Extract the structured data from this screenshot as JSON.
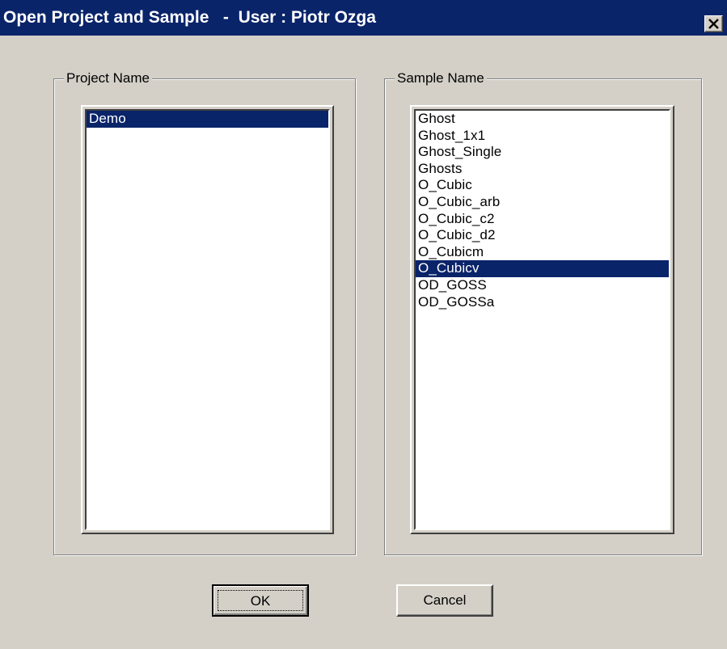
{
  "window": {
    "title": "Open Project and Sample   -  User : Piotr Ozga",
    "close_icon": "close-icon"
  },
  "project_group": {
    "label": "Project Name",
    "items": [
      "Demo"
    ],
    "selected_index": 0
  },
  "sample_group": {
    "label": "Sample Name",
    "items": [
      "Ghost",
      "Ghost_1x1",
      "Ghost_Single",
      "Ghosts",
      "O_Cubic",
      "O_Cubic_arb",
      "O_Cubic_c2",
      "O_Cubic_d2",
      "O_Cubicm",
      "O_Cubicv",
      "OD_GOSS",
      "OD_GOSSa"
    ],
    "selected_index": 9
  },
  "buttons": {
    "ok_label": "OK",
    "cancel_label": "Cancel"
  },
  "colors": {
    "titlebar": "#0a246a",
    "selection": "#0a246a",
    "face": "#d4d0c8"
  }
}
